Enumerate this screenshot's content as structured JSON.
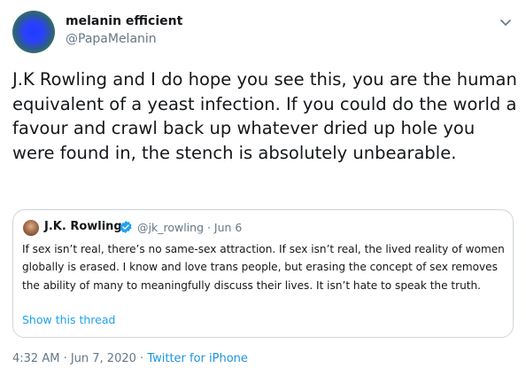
{
  "author": {
    "display_name": "melanin efficient",
    "handle": "@PapaMelanin"
  },
  "tweet": {
    "text": "J.K Rowling and I do hope you see this, you are the human equivalent of a yeast infection. If you could do the world a favour and crawl back up whatever dried up hole you were found in, the stench is absolutely unbearable."
  },
  "quoted_tweet": {
    "display_name": "J.K. Rowling",
    "handle_date": "@jk_rowling · Jun 6",
    "text": "If sex isn’t real, there’s no same-sex attraction. If sex isn’t real, the lived reality of women globally is erased. I know and love trans people, but erasing the concept of sex removes the ability of many to meaningfully discuss their lives. It isn’t hate to speak the truth.",
    "show_thread": "Show this thread"
  },
  "meta": {
    "timestamp": "4:32 AM · Jun 7, 2020",
    "separator": " · ",
    "source": "Twitter for iPhone"
  },
  "colors": {
    "text": "#14171a",
    "secondary": "#657786",
    "link": "#1da1f2",
    "border": "#ccd6dd"
  },
  "icons": {
    "caret": "chevron-down-icon",
    "verified": "verified-badge-icon"
  }
}
